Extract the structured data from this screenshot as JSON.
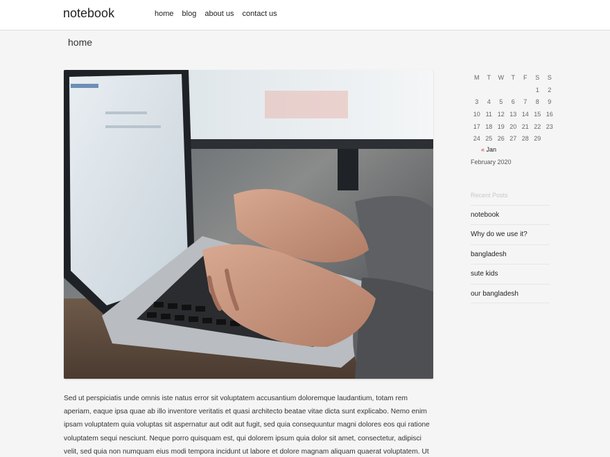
{
  "header": {
    "brand": "notebook",
    "nav": [
      "home",
      "blog",
      "about us",
      "contact us"
    ]
  },
  "page": {
    "title": "home"
  },
  "hero": {
    "icon": "laptop-typing-photo"
  },
  "article": {
    "text": "Sed ut perspiciatis unde omnis iste natus error sit voluptatem accusantium doloremque laudantium, totam rem aperiam, eaque ipsa quae ab illo inventore veritatis et quasi architecto beatae vitae dicta sunt explicabo. Nemo enim ipsam voluptatem quia voluptas sit aspernatur aut odit aut fugit, sed quia consequuntur magni dolores eos qui ratione voluptatem sequi nesciunt. Neque porro quisquam est, qui dolorem ipsum quia dolor sit amet, consectetur, adipisci velit, sed quia non numquam eius modi tempora incidunt ut labore et dolore magnam aliquam quaerat voluptatem. Ut enim ad minima veniam, quis nostrum exercitationem ullam corporis suscipit"
  },
  "calendar": {
    "weekdays": [
      "M",
      "T",
      "W",
      "T",
      "F",
      "S",
      "S"
    ],
    "weeks": [
      [
        "",
        "",
        "",
        "",
        "",
        "1",
        "2"
      ],
      [
        "3",
        "4",
        "5",
        "6",
        "7",
        "8",
        "9"
      ],
      [
        "10",
        "11",
        "12",
        "13",
        "14",
        "15",
        "16"
      ],
      [
        "17",
        "18",
        "19",
        "20",
        "21",
        "22",
        "23"
      ],
      [
        "24",
        "25",
        "26",
        "27",
        "28",
        "29",
        ""
      ]
    ],
    "prev_arrow": "«",
    "prev_label": "Jan",
    "caption": "February 2020"
  },
  "recent": {
    "title": "Recent Posts",
    "items": [
      "notebook",
      "Why do we use it?",
      "bangladesh",
      "sute kids",
      "our bangladesh"
    ]
  },
  "colors": {
    "accent_arrow": "#c0392b",
    "background": "#f5f5f5"
  }
}
